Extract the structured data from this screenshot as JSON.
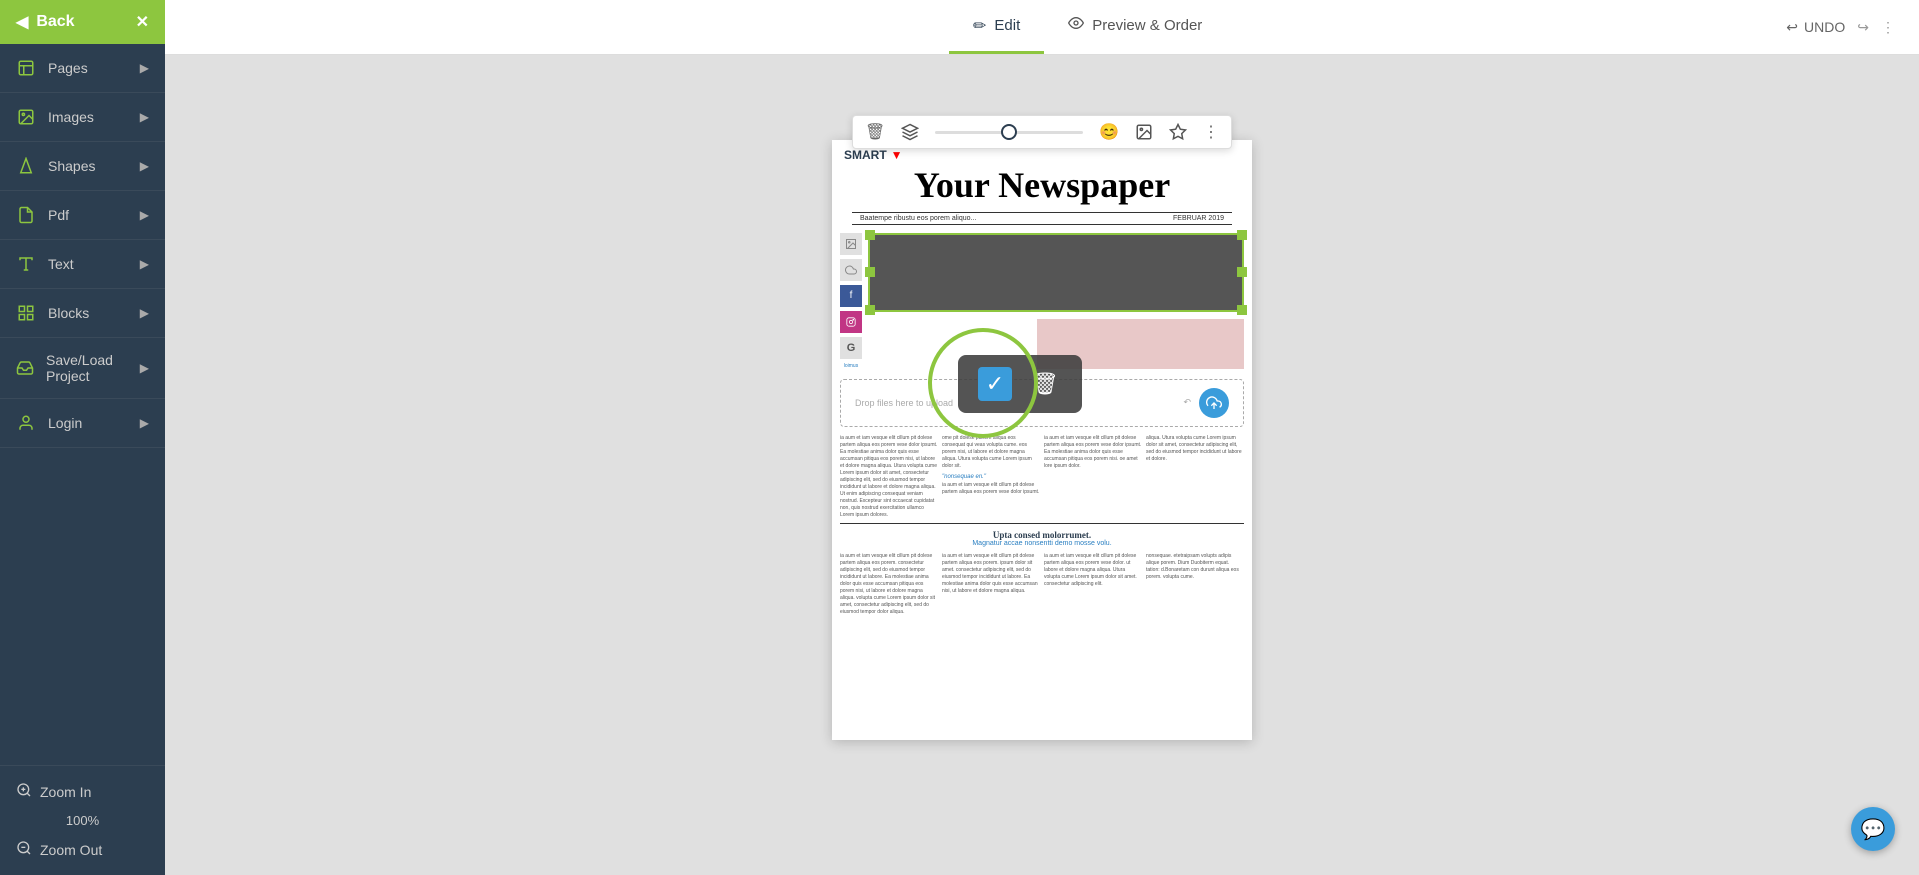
{
  "sidebar": {
    "back_label": "Back",
    "items": [
      {
        "id": "pages",
        "label": "Pages",
        "icon": "📄"
      },
      {
        "id": "images",
        "label": "Images",
        "icon": "🖼"
      },
      {
        "id": "shapes",
        "label": "Shapes",
        "icon": "⬡"
      },
      {
        "id": "pdf",
        "label": "Pdf",
        "icon": "📑"
      },
      {
        "id": "text",
        "label": "Text",
        "icon": "🔤"
      },
      {
        "id": "blocks",
        "label": "Blocks",
        "icon": "⬜"
      },
      {
        "id": "save_load",
        "label": "Save/Load Project",
        "icon": "☁"
      },
      {
        "id": "login",
        "label": "Login",
        "icon": "👤"
      }
    ],
    "zoom_in": "Zoom In",
    "zoom_level": "100%",
    "zoom_out": "Zoom Out"
  },
  "header": {
    "tabs": [
      {
        "id": "edit",
        "label": "Edit",
        "icon": "✏",
        "active": true
      },
      {
        "id": "preview",
        "label": "Preview & Order",
        "icon": "👁",
        "active": false
      }
    ],
    "undo_label": "UNDO"
  },
  "toolbar": {
    "delete_icon": "🗑",
    "layers_icon": "⧉",
    "slider_value": 50,
    "emoji_icon": "😊",
    "image_icon": "🖼",
    "star_icon": "★",
    "more_icon": "⋮"
  },
  "page": {
    "logo": "SMART",
    "title": "Your Newspaper",
    "subtitle_left": "Baatempe ribustu eos porem aliquo...",
    "subtitle_right": "FEBRUAR 2019",
    "upload_text": "Drop files here to upload",
    "section_title": "Upta consed molorrumet.",
    "section_subtitle": "Magnatur accae nonsentti demo mosse volu.",
    "confirm_check": "✓",
    "confirm_trash": "🗑"
  },
  "chat": {
    "icon": "💬"
  }
}
